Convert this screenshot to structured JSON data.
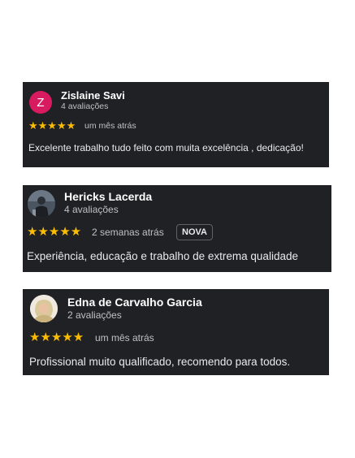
{
  "colors": {
    "card_background": "#202124",
    "star": "#fbbc04",
    "page_background": "#ffffff",
    "avatar_1": "#d81b60"
  },
  "reviews": [
    {
      "avatar_letter": "Z",
      "avatar_icon": "letter-avatar-icon",
      "name": "Zislaine Savi",
      "review_count": "4 avaliações",
      "stars": "★★★★★",
      "rating": 5,
      "time": "um mês atrás",
      "text": "Excelente trabalho tudo feito com muita excelência , dedicação!"
    },
    {
      "avatar_icon": "profile-photo-icon",
      "name": "Hericks Lacerda",
      "review_count": "4 avaliações",
      "stars": "★★★★★",
      "rating": 5,
      "time": "2 semanas atrás",
      "badge": "NOVA",
      "text": "Experiência, educação e trabalho de extrema qualidade"
    },
    {
      "avatar_icon": "profile-photo-icon",
      "name": "Edna de Carvalho Garcia",
      "review_count": "2 avaliações",
      "stars": "★★★★★",
      "rating": 5,
      "time": "um mês atrás",
      "text": "Profissional muito qualificado, recomendo para todos."
    }
  ]
}
